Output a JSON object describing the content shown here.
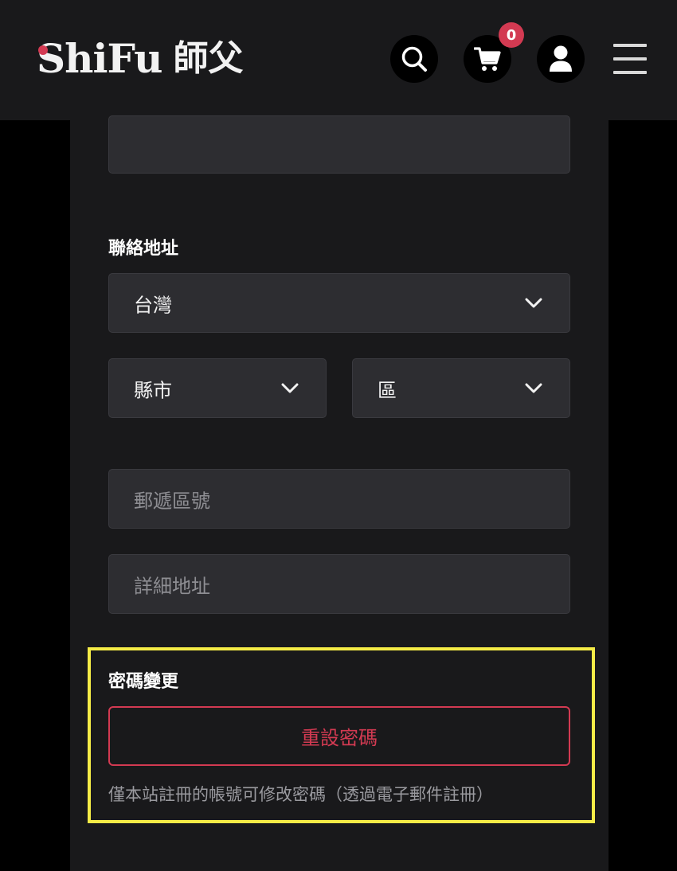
{
  "header": {
    "logo_latin": "ShiFu",
    "logo_cjk": "師父",
    "cart_count": "0",
    "icons": [
      "search-icon",
      "cart-icon",
      "user-icon",
      "hamburger-menu-icon"
    ],
    "accent_color": "#d33a52"
  },
  "form": {
    "address_label": "聯絡地址",
    "country_value": "台灣",
    "city_placeholder": "縣市",
    "district_placeholder": "區",
    "postal_placeholder": "郵遞區號",
    "address_placeholder": "詳細地址"
  },
  "password": {
    "section_label": "密碼變更",
    "reset_button": "重設密碼",
    "note": "僅本站註冊的帳號可修改密碼（透過電子郵件註冊）"
  },
  "colors": {
    "highlight": "#f5ec47",
    "field_bg": "#2d2d31",
    "panel_bg": "#19191b"
  }
}
